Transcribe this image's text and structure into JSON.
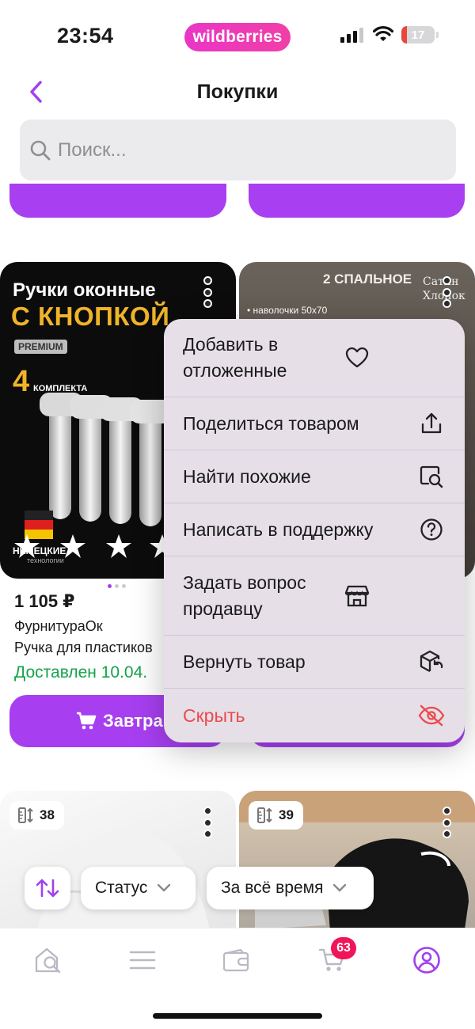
{
  "status_bar": {
    "time": "23:54",
    "brand": "wildberries",
    "battery": "17",
    "battery_level": 0.17
  },
  "header": {
    "title": "Покупки"
  },
  "search": {
    "placeholder": "Поиск..."
  },
  "product_1": {
    "image_title_line1": "Ручки оконные",
    "image_title_line2": "С КНОПКОЙ",
    "image_badge": "PREMIUM",
    "image_count": "4",
    "image_count_label": "КОМПЛЕКТА",
    "image_caption": "НЕМЕЦКИЕ",
    "image_subcaption": "технологии",
    "price": "1 105 ₽",
    "seller": "ФурнитураОк",
    "name": "Ручка для пластиков",
    "delivery": "Доставлен 10.04.",
    "cart_label": "Завтра"
  },
  "product_2": {
    "image_title": "2 СПАЛЬНОЕ",
    "image_side": "Сатин Хлопок",
    "image_note": "• наволочки 50х70"
  },
  "product_3": {
    "size": "38"
  },
  "product_4": {
    "size": "39"
  },
  "context_menu": {
    "items": [
      {
        "label": "Добавить в отложенные",
        "icon": "heart-icon"
      },
      {
        "label": "Поделиться товаром",
        "icon": "share-icon"
      },
      {
        "label": "Найти похожие",
        "icon": "image-search-icon"
      },
      {
        "label": "Написать в поддержку",
        "icon": "help-icon"
      },
      {
        "label": "Задать вопрос продавцу",
        "icon": "store-icon"
      },
      {
        "label": "Вернуть товар",
        "icon": "return-box-icon"
      },
      {
        "label": "Скрыть",
        "icon": "eye-off-icon"
      }
    ]
  },
  "filters": {
    "status": "Статус",
    "period": "За всё время"
  },
  "tabbar": {
    "cart_count": "63"
  },
  "colors": {
    "accent": "#a73ff0",
    "danger": "#ea4b4b",
    "success": "#16a34a",
    "badge": "#f0145a"
  }
}
